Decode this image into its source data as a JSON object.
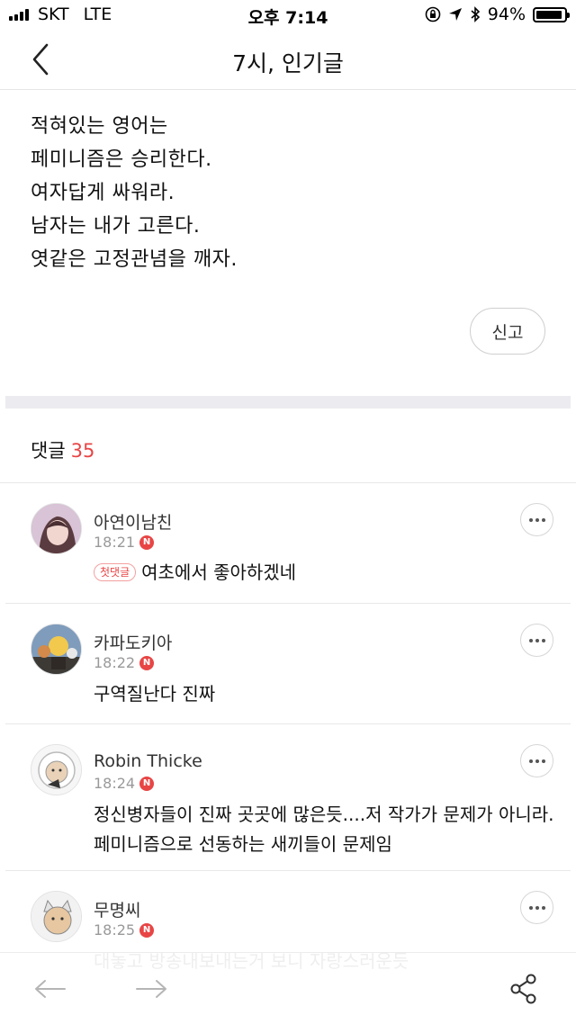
{
  "status_bar": {
    "carrier": "SKT",
    "network": "LTE",
    "time": "오후 7:14",
    "battery_percent": "94%",
    "battery_level": 0.94
  },
  "header": {
    "title": "7시, 인기글",
    "back_icon": "chevron-left-icon"
  },
  "article": {
    "lines": [
      "적혀있는 영어는",
      "페미니즘은 승리한다.",
      "여자답게 싸워라.",
      "남자는 내가 고른다.",
      "엿같은 고정관념을 깨자."
    ],
    "report_label": "신고"
  },
  "comments_section": {
    "label": "댓글",
    "count": "35"
  },
  "comments": [
    {
      "author": "아연이남친",
      "time": "18:21",
      "new_badge": "N",
      "first_badge": "첫댓글",
      "text": "여초에서 좋아하겠네"
    },
    {
      "author": "카파도키아",
      "time": "18:22",
      "new_badge": "N",
      "text": "구역질난다 진짜"
    },
    {
      "author": "Robin Thicke",
      "time": "18:24",
      "new_badge": "N",
      "text": "정신병자들이 진짜 곳곳에 많은듯....저 작가가 문제가 아니라. 페미니즘으로 선동하는 새끼들이 문제임"
    },
    {
      "author": "무명씨",
      "time": "18:25",
      "new_badge": "N",
      "text": "대놓고 방송내보내는거 보니 자랑스러운듯"
    }
  ],
  "toolbar": {
    "back_icon": "arrow-left-icon",
    "forward_icon": "arrow-right-icon",
    "share_icon": "share-icon"
  },
  "colors": {
    "accent": "#e84545",
    "divider": "#ececf0"
  }
}
